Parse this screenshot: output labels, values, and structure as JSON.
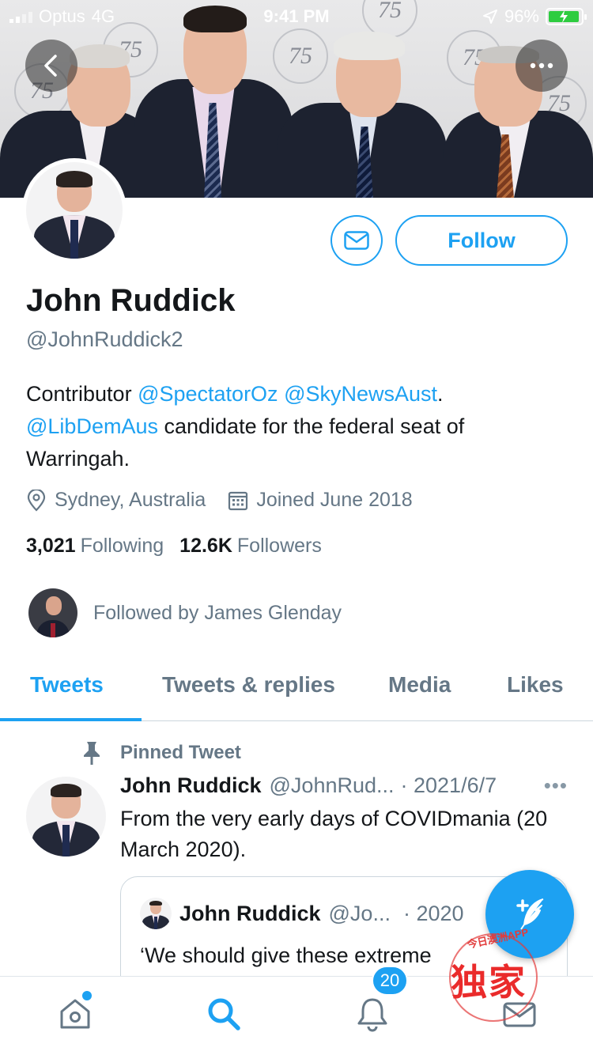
{
  "status_bar": {
    "carrier": "Optus",
    "network": "4G",
    "time": "9:41 PM",
    "battery": "96%"
  },
  "banner": {
    "wall_logo_text": "75"
  },
  "profile": {
    "follow_label": "Follow",
    "name": "John Ruddick",
    "handle": "@JohnRuddick2",
    "bio": {
      "part1": "Contributor ",
      "mention1": "@SpectatorOz",
      "space": " ",
      "mention2": "@SkyNewsAust",
      "part2": ". ",
      "mention3": "@LibDemAus",
      "part3": " candidate for the federal seat of Warringah."
    },
    "location": "Sydney, Australia",
    "joined": "Joined June 2018",
    "following_count": "3,021",
    "following_label": "Following",
    "followers_count": "12.6K",
    "followers_label": "Followers",
    "followed_by": "Followed by James Glenday"
  },
  "tabs": [
    "Tweets",
    "Tweets & replies",
    "Media",
    "Likes"
  ],
  "pinned_tweet": {
    "label": "Pinned Tweet",
    "name": "John Ruddick",
    "handle": "@JohnRud...",
    "date": "· 2021/6/7",
    "more": "•••",
    "text": "From the very early days of COVIDmania (20 March 2020).",
    "quote": {
      "name": "John Ruddick",
      "handle": "@Jo...",
      "date": "· 2020",
      "text": "‘We should give these extreme"
    }
  },
  "watermark": {
    "app": "今日澳洲APP",
    "big": "独家"
  },
  "tabbar": {
    "notifications_badge": "20"
  },
  "colors": {
    "accent": "#1da1f2",
    "secondary_text": "#657786"
  }
}
